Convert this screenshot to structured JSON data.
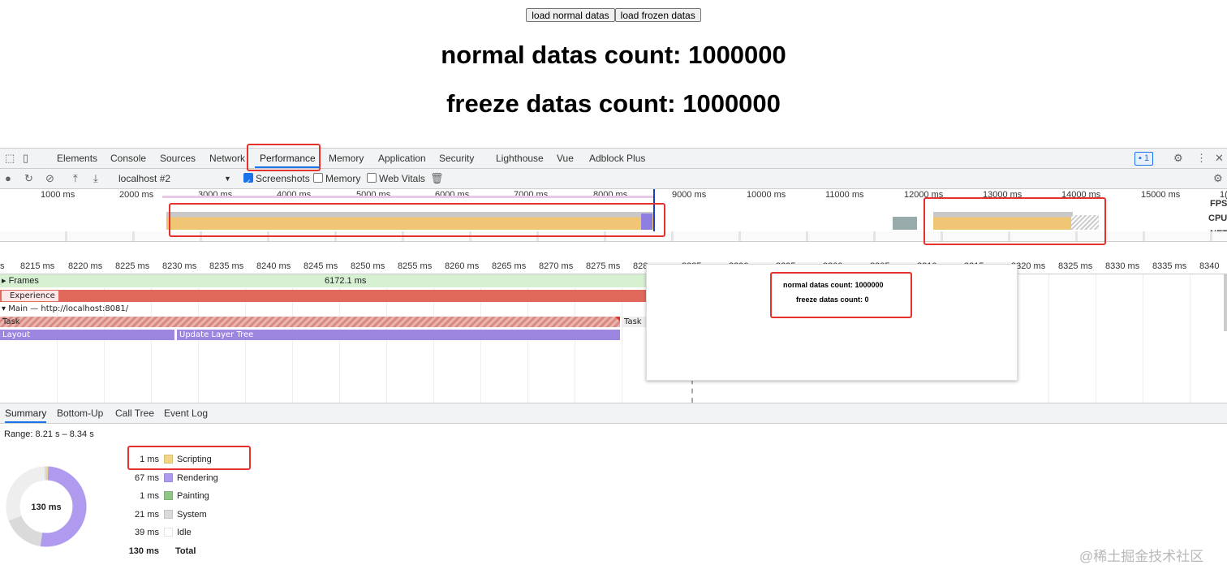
{
  "page": {
    "buttons": {
      "load_normal": "load normal datas",
      "load_frozen": "load frozen datas"
    },
    "normal_count_text": "normal datas count: 1000000",
    "freeze_count_text": "freeze datas count: 1000000"
  },
  "devtools": {
    "tabs": [
      "Elements",
      "Console",
      "Sources",
      "Network",
      "Performance",
      "Memory",
      "Application",
      "Security",
      "Lighthouse",
      "Vue",
      "Adblock Plus"
    ],
    "active_tab": "Performance",
    "issues_badge": "1",
    "toolbar": {
      "profile_select": "localhost #2",
      "screenshots_label": "Screenshots",
      "screenshots_checked": true,
      "memory_label": "Memory",
      "memory_checked": false,
      "webvitals_label": "Web Vitals",
      "webvitals_checked": false
    },
    "overview": {
      "ticks": [
        "1000 ms",
        "2000 ms",
        "3000 ms",
        "4000 ms",
        "5000 ms",
        "6000 ms",
        "7000 ms",
        "8000 ms",
        "9000 ms",
        "10000 ms",
        "11000 ms",
        "12000 ms",
        "13000 ms",
        "14000 ms",
        "15000 ms",
        "1("
      ],
      "side_labels": [
        "FPS",
        "CPU",
        "NET"
      ]
    },
    "ruler_ticks": [
      "s",
      "8215 ms",
      "8220 ms",
      "8225 ms",
      "8230 ms",
      "8235 ms",
      "8240 ms",
      "8245 ms",
      "8250 ms",
      "8255 ms",
      "8260 ms",
      "8265 ms",
      "8270 ms",
      "8275 ms",
      "828",
      "8285 ms",
      "8290 ms",
      "8295 ms",
      "8300 ms",
      "8305 ms",
      "8310 ms",
      "8315 ms",
      "8320 ms",
      "8325 ms",
      "8330 ms",
      "8335 ms",
      "8340"
    ],
    "tracks": {
      "frames_label": "Frames",
      "frames_value": "6172.1 ms",
      "experience_label": "Experience",
      "main_label": "Main — http://localhost:8081/",
      "task_label": "Task",
      "task_label_2": "Task",
      "layout_label": "Layout",
      "update_layer_tree_label": "Update Layer Tree"
    },
    "screenshot_popup": {
      "line1": "normal datas count: 1000000",
      "line2": "freeze datas count: 0"
    },
    "bottom_tabs": [
      "Summary",
      "Bottom-Up",
      "Call Tree",
      "Event Log"
    ],
    "active_bottom_tab": "Summary",
    "summary": {
      "range": "Range: 8.21 s – 8.34 s",
      "total_center": "130 ms",
      "rows": [
        {
          "value": "1 ms",
          "label": "Scripting",
          "color": "#f2d486"
        },
        {
          "value": "67 ms",
          "label": "Rendering",
          "color": "#af9af0"
        },
        {
          "value": "1 ms",
          "label": "Painting",
          "color": "#8fc585"
        },
        {
          "value": "21 ms",
          "label": "System",
          "color": "#dadada"
        },
        {
          "value": "39 ms",
          "label": "Idle",
          "color": "#ffffff"
        }
      ],
      "total_value": "130 ms",
      "total_label": "Total"
    }
  },
  "watermark": "@稀土掘金技术社区"
}
